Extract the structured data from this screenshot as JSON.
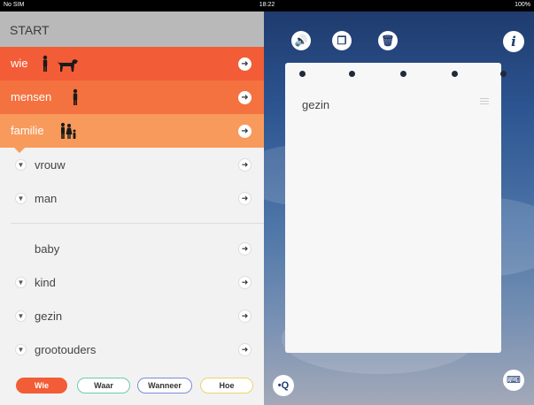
{
  "status_bar": {
    "carrier": "No SIM",
    "time": "18:22",
    "battery": "100%"
  },
  "left_panel": {
    "start_label": "START",
    "breadcrumbs": [
      {
        "label": "wie",
        "icons": [
          "person-icon",
          "dog-icon"
        ],
        "color": "#f25c36"
      },
      {
        "label": "mensen",
        "icons": [
          "person-icon"
        ],
        "color": "#f4723f"
      },
      {
        "label": "familie",
        "icons": [
          "family-icon"
        ],
        "color": "#f89a5c"
      }
    ],
    "items": [
      {
        "label": "vrouw",
        "expandable": true
      },
      {
        "label": "man",
        "expandable": true
      },
      {
        "label": "baby",
        "expandable": false
      },
      {
        "label": "kind",
        "expandable": true
      },
      {
        "label": "gezin",
        "expandable": true
      },
      {
        "label": "grootouders",
        "expandable": true
      }
    ],
    "question_buttons": [
      {
        "label": "Wie",
        "color": "#f25c36",
        "selected": true
      },
      {
        "label": "Waar",
        "color": "#6cc9b3",
        "selected": false
      },
      {
        "label": "Wanneer",
        "color": "#7b8cd6",
        "selected": false
      },
      {
        "label": "Hoe",
        "color": "#ecd36a",
        "selected": false
      }
    ]
  },
  "right_panel": {
    "toolbar_icons": [
      "speaker-icon",
      "copy-icon",
      "trash-icon",
      "info-icon"
    ],
    "card": {
      "word": "gezin"
    },
    "bottom_icons": [
      "search-icon",
      "keyboard-icon"
    ]
  }
}
